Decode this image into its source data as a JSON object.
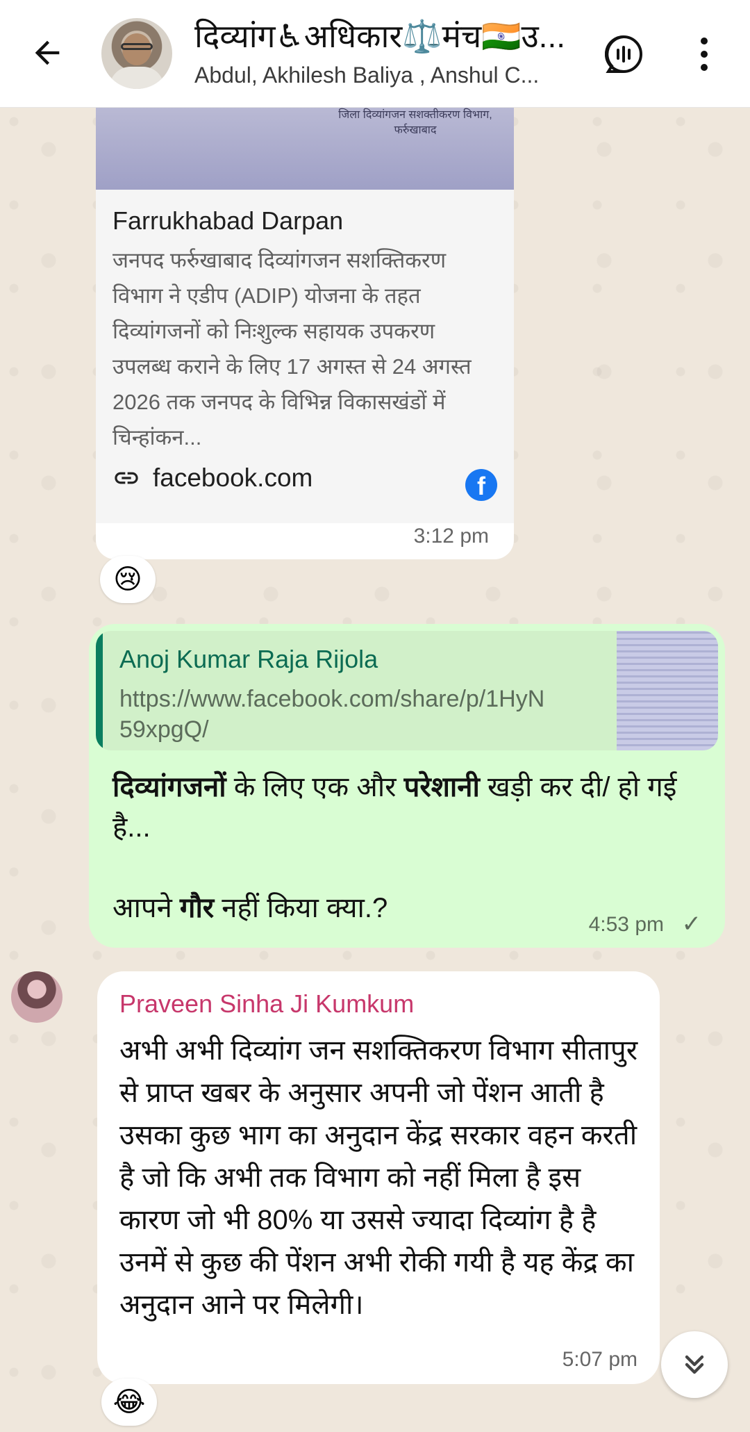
{
  "header": {
    "title": "दिव्यांग♿अधिकार⚖️मंच🇮🇳उ...",
    "subtitle": "Abdul, Akhilesh Baliya , Anshul C..."
  },
  "messages": [
    {
      "type": "link-preview",
      "preview_image_text": "जिला दिव्यांगजन सशक्तीकरण विभाग, फर्रुखाबाद",
      "site_title": "Farrukhabad Darpan",
      "description": "जनपद फर्रुखाबाद दिव्यांगजन सशक्तिकरण विभाग ने एडीप (ADIP) योजना के तहत दिव्यांगजनों को निःशुल्क सहायक उपकरण उपलब्ध कराने के लिए 17 अगस्त से 24 अगस्त 2026 तक जनपद के विभिन्न विकासखंडों में चिन्हांकन...",
      "domain": "facebook.com",
      "time": "3:12 pm",
      "reaction": "😢"
    },
    {
      "type": "outgoing",
      "quoted_author": "Anoj Kumar Raja Rijola",
      "quoted_text": "https://www.facebook.com/share/p/1HyN59xpgQ/",
      "body_bold_1": "दिव्यांगजनों",
      "body_part_1": " के लिए एक और ",
      "body_bold_2": "परेशानी",
      "body_part_2": " खड़ी कर दी/ हो गई है...",
      "body_part_3": "आपने ",
      "body_bold_3": "गौर",
      "body_part_4": " नहीं किया क्या.?",
      "time": "4:53 pm",
      "status": "✓"
    },
    {
      "type": "incoming",
      "sender": "Praveen Sinha Ji Kumkum",
      "text": "अभी अभी दिव्यांग जन सशक्तिकरण विभाग सीतापुर से प्राप्त खबर के अनुसार अपनी जो पेंशन आती है उसका कुछ भाग का अनुदान केंद्र सरकार वहन करती है जो कि अभी तक विभाग को नहीं मिला है इस कारण जो भी 80% या उससे ज्यादा दिव्यांग है है उनमें से कुछ की पेंशन अभी रोकी गयी है यह केंद्र का अनुदान आने पर मिलेगी।",
      "time": "5:07 pm",
      "reaction": "😂"
    }
  ],
  "icons": {
    "back": "arrow-back-icon",
    "voice_chat": "voice-chat-icon",
    "menu": "more-vert-icon",
    "link": "link-icon",
    "facebook": "facebook-icon",
    "scroll_down": "chevron-double-down-icon"
  }
}
